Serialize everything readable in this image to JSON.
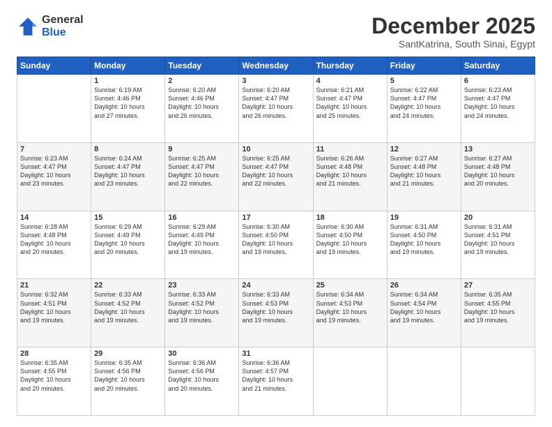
{
  "logo": {
    "general": "General",
    "blue": "Blue"
  },
  "title": "December 2025",
  "location": "SantKatrina, South Sinai, Egypt",
  "days": [
    "Sunday",
    "Monday",
    "Tuesday",
    "Wednesday",
    "Thursday",
    "Friday",
    "Saturday"
  ],
  "weeks": [
    [
      {
        "num": "",
        "info": ""
      },
      {
        "num": "1",
        "info": "Sunrise: 6:19 AM\nSunset: 4:46 PM\nDaylight: 10 hours\nand 27 minutes."
      },
      {
        "num": "2",
        "info": "Sunrise: 6:20 AM\nSunset: 4:46 PM\nDaylight: 10 hours\nand 26 minutes."
      },
      {
        "num": "3",
        "info": "Sunrise: 6:20 AM\nSunset: 4:47 PM\nDaylight: 10 hours\nand 26 minutes."
      },
      {
        "num": "4",
        "info": "Sunrise: 6:21 AM\nSunset: 4:47 PM\nDaylight: 10 hours\nand 25 minutes."
      },
      {
        "num": "5",
        "info": "Sunrise: 6:22 AM\nSunset: 4:47 PM\nDaylight: 10 hours\nand 24 minutes."
      },
      {
        "num": "6",
        "info": "Sunrise: 6:23 AM\nSunset: 4:47 PM\nDaylight: 10 hours\nand 24 minutes."
      }
    ],
    [
      {
        "num": "7",
        "info": "Sunrise: 6:23 AM\nSunset: 4:47 PM\nDaylight: 10 hours\nand 23 minutes."
      },
      {
        "num": "8",
        "info": "Sunrise: 6:24 AM\nSunset: 4:47 PM\nDaylight: 10 hours\nand 23 minutes."
      },
      {
        "num": "9",
        "info": "Sunrise: 6:25 AM\nSunset: 4:47 PM\nDaylight: 10 hours\nand 22 minutes."
      },
      {
        "num": "10",
        "info": "Sunrise: 6:25 AM\nSunset: 4:47 PM\nDaylight: 10 hours\nand 22 minutes."
      },
      {
        "num": "11",
        "info": "Sunrise: 6:26 AM\nSunset: 4:48 PM\nDaylight: 10 hours\nand 21 minutes."
      },
      {
        "num": "12",
        "info": "Sunrise: 6:27 AM\nSunset: 4:48 PM\nDaylight: 10 hours\nand 21 minutes."
      },
      {
        "num": "13",
        "info": "Sunrise: 6:27 AM\nSunset: 4:48 PM\nDaylight: 10 hours\nand 20 minutes."
      }
    ],
    [
      {
        "num": "14",
        "info": "Sunrise: 6:28 AM\nSunset: 4:48 PM\nDaylight: 10 hours\nand 20 minutes."
      },
      {
        "num": "15",
        "info": "Sunrise: 6:29 AM\nSunset: 4:49 PM\nDaylight: 10 hours\nand 20 minutes."
      },
      {
        "num": "16",
        "info": "Sunrise: 6:29 AM\nSunset: 4:49 PM\nDaylight: 10 hours\nand 19 minutes."
      },
      {
        "num": "17",
        "info": "Sunrise: 6:30 AM\nSunset: 4:50 PM\nDaylight: 10 hours\nand 19 minutes."
      },
      {
        "num": "18",
        "info": "Sunrise: 6:30 AM\nSunset: 4:50 PM\nDaylight: 10 hours\nand 19 minutes."
      },
      {
        "num": "19",
        "info": "Sunrise: 6:31 AM\nSunset: 4:50 PM\nDaylight: 10 hours\nand 19 minutes."
      },
      {
        "num": "20",
        "info": "Sunrise: 6:31 AM\nSunset: 4:51 PM\nDaylight: 10 hours\nand 19 minutes."
      }
    ],
    [
      {
        "num": "21",
        "info": "Sunrise: 6:32 AM\nSunset: 4:51 PM\nDaylight: 10 hours\nand 19 minutes."
      },
      {
        "num": "22",
        "info": "Sunrise: 6:33 AM\nSunset: 4:52 PM\nDaylight: 10 hours\nand 19 minutes."
      },
      {
        "num": "23",
        "info": "Sunrise: 6:33 AM\nSunset: 4:52 PM\nDaylight: 10 hours\nand 19 minutes."
      },
      {
        "num": "24",
        "info": "Sunrise: 6:33 AM\nSunset: 4:53 PM\nDaylight: 10 hours\nand 19 minutes."
      },
      {
        "num": "25",
        "info": "Sunrise: 6:34 AM\nSunset: 4:53 PM\nDaylight: 10 hours\nand 19 minutes."
      },
      {
        "num": "26",
        "info": "Sunrise: 6:34 AM\nSunset: 4:54 PM\nDaylight: 10 hours\nand 19 minutes."
      },
      {
        "num": "27",
        "info": "Sunrise: 6:35 AM\nSunset: 4:55 PM\nDaylight: 10 hours\nand 19 minutes."
      }
    ],
    [
      {
        "num": "28",
        "info": "Sunrise: 6:35 AM\nSunset: 4:55 PM\nDaylight: 10 hours\nand 20 minutes."
      },
      {
        "num": "29",
        "info": "Sunrise: 6:35 AM\nSunset: 4:56 PM\nDaylight: 10 hours\nand 20 minutes."
      },
      {
        "num": "30",
        "info": "Sunrise: 6:36 AM\nSunset: 4:56 PM\nDaylight: 10 hours\nand 20 minutes."
      },
      {
        "num": "31",
        "info": "Sunrise: 6:36 AM\nSunset: 4:57 PM\nDaylight: 10 hours\nand 21 minutes."
      },
      {
        "num": "",
        "info": ""
      },
      {
        "num": "",
        "info": ""
      },
      {
        "num": "",
        "info": ""
      }
    ]
  ]
}
